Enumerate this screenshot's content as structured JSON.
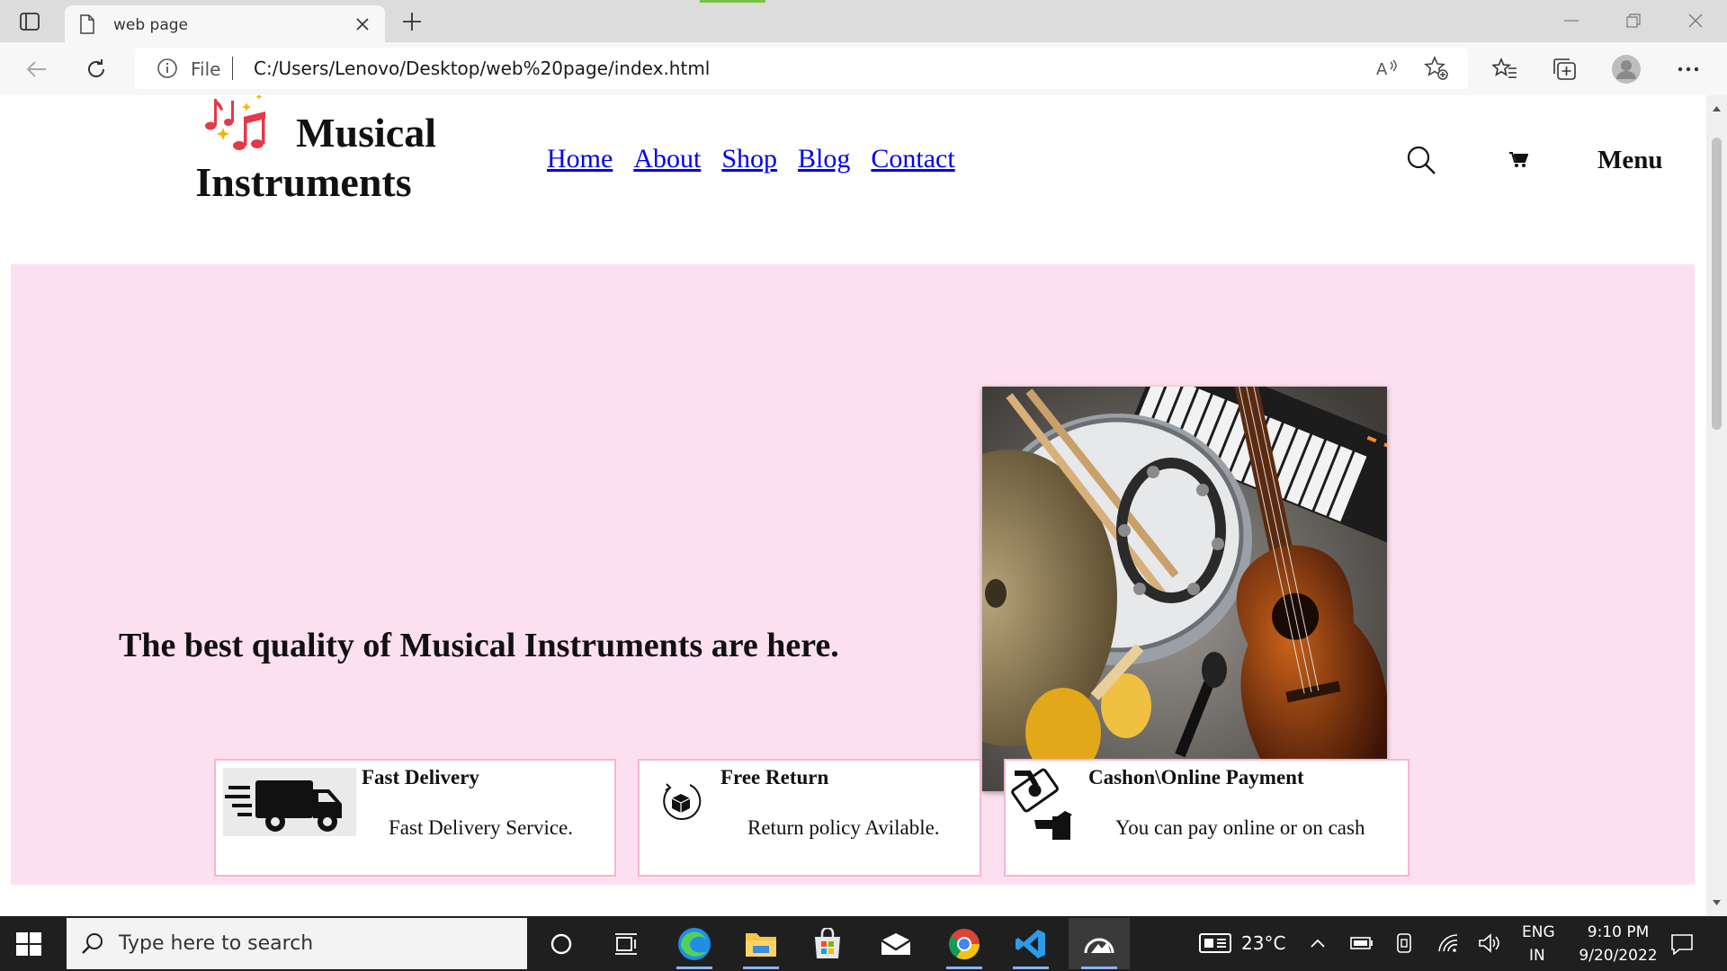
{
  "browser": {
    "tab_title": "web page",
    "address_scheme": "File",
    "url": "C:/Users/Lenovo/Desktop/web%20page/index.html"
  },
  "site": {
    "logo_line1": "Musical",
    "logo_line2": "Instruments",
    "nav": [
      "Home",
      "About",
      "Shop",
      "Blog",
      "Contact"
    ],
    "menu_label": "Menu"
  },
  "hero": {
    "heading": "The best quality of Musical Instruments are here.",
    "image_alt": "musical instruments"
  },
  "features": [
    {
      "title": "Fast Delivery",
      "description": "Fast Delivery Service.",
      "icon": "delivery-truck-icon"
    },
    {
      "title": "Free Return",
      "description": "Return policy Avilable.",
      "icon": "return-box-icon"
    },
    {
      "title": "Cashon\\Online Payment",
      "description": "You can pay online or on cash",
      "icon": "payment-hand-icon"
    }
  ],
  "taskbar": {
    "search_placeholder": "Type here to search",
    "weather": "23°C",
    "language": "ENG",
    "region": "IN",
    "time": "9:10 PM",
    "date": "9/20/2022"
  },
  "colors": {
    "hero_background": "#fde0ef",
    "feature_border": "#f7b4d2",
    "link": "#0000ee"
  }
}
